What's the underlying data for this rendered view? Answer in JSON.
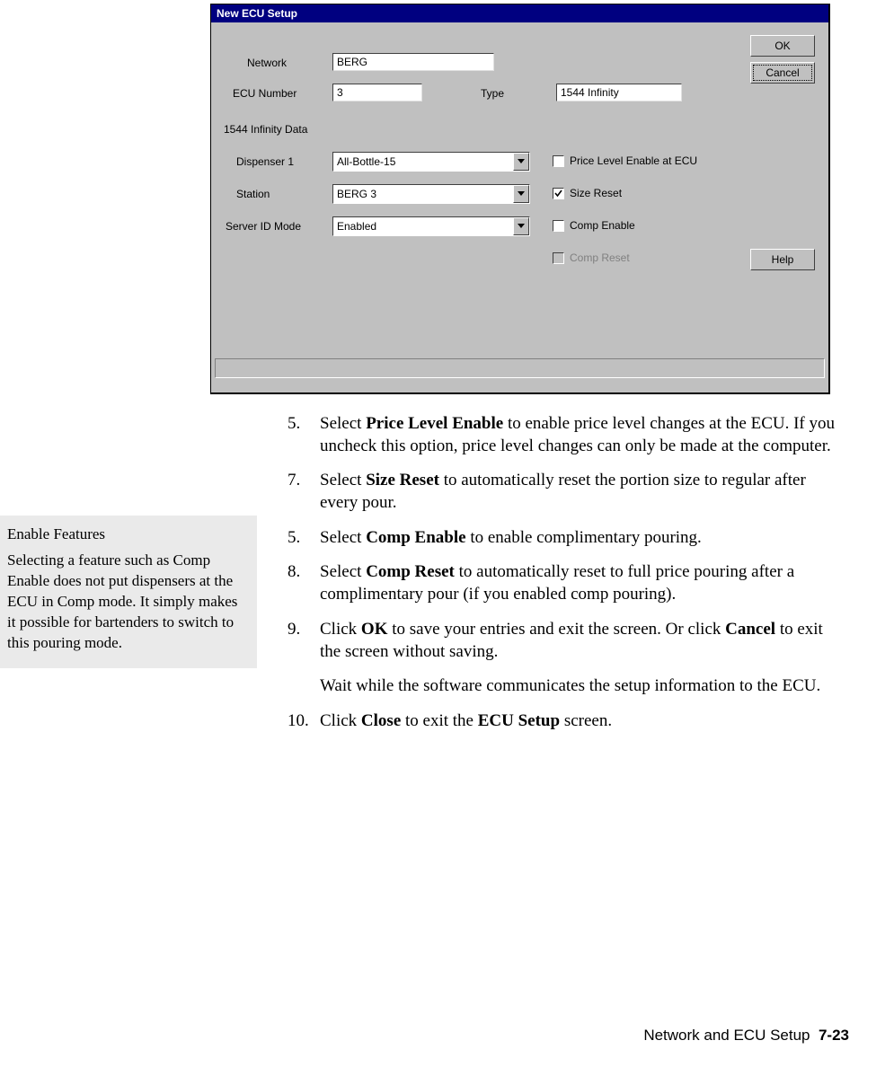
{
  "dialog": {
    "title": "New ECU Setup",
    "fields": {
      "network_label": "Network",
      "network_value": "BERG",
      "ecu_number_label": "ECU Number",
      "ecu_number_value": "3",
      "type_label": "Type",
      "type_value": "1544 Infinity",
      "section_label": "1544 Infinity Data",
      "dispenser_label": "Dispenser 1",
      "dispenser_value": "All-Bottle-15",
      "station_label": "Station",
      "station_value": "BERG 3",
      "server_id_label": "Server ID Mode",
      "server_id_value": "Enabled"
    },
    "checkboxes": {
      "price_level_label": "Price Level Enable at ECU",
      "price_level_checked": false,
      "size_reset_label": "Size Reset",
      "size_reset_checked": true,
      "comp_enable_label": "Comp Enable",
      "comp_enable_checked": false,
      "comp_reset_label": "Comp Reset",
      "comp_reset_checked": false
    },
    "buttons": {
      "ok": "OK",
      "cancel": "Cancel",
      "help": "Help"
    }
  },
  "sidebar": {
    "title": "Enable Features",
    "body": "Selecting a feature such as Comp Enable does not put dispensers at the ECU in Comp mode. It simply makes it possible for bartenders to switch to this pouring mode."
  },
  "steps": [
    {
      "num": "5.",
      "pre": "Select ",
      "bold": "Price Level Enable",
      "post": " to enable price level changes at the ECU. If you uncheck this option, price level changes can only be made at the computer."
    },
    {
      "num": "7.",
      "pre": "Select ",
      "bold": "Size Reset",
      "post": " to automatically reset the portion size to regular after every pour."
    },
    {
      "num": "5.",
      "pre": "Select ",
      "bold": "Comp Enable",
      "post": " to enable complimentary pouring."
    },
    {
      "num": "8.",
      "pre": "Select ",
      "bold": "Comp Reset",
      "post": " to automatically reset to full price pouring after a complimentary pour (if you enabled comp pouring)."
    },
    {
      "num": "9.",
      "pre": "Click ",
      "bold": "OK",
      "post": " to save your entries and exit the screen. Or click ",
      "bold2": "Cancel",
      "post2": " to exit the screen without saving.",
      "followup": "Wait while the software communicates the setup information to the ECU."
    },
    {
      "num": "10.",
      "pre": "Click ",
      "bold": "Close",
      "post": " to exit the ",
      "bold2": "ECU Setup",
      "post2": " screen."
    }
  ],
  "footer": {
    "text": "Network and ECU Setup",
    "page": "7-23"
  }
}
